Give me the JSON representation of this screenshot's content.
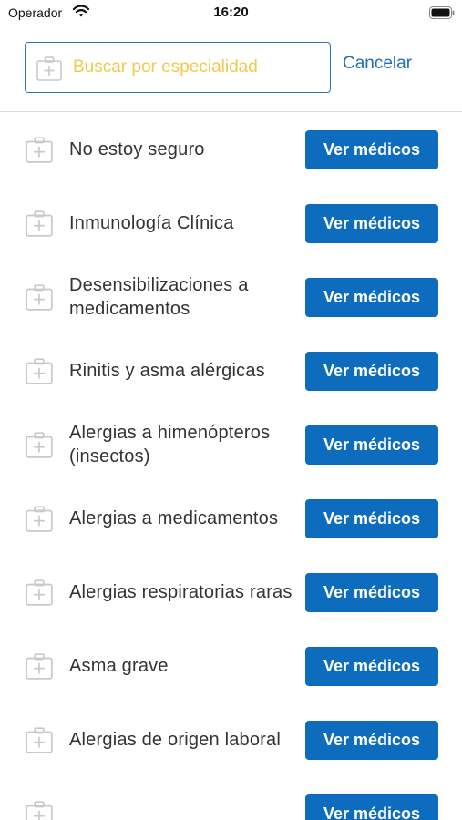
{
  "status_bar": {
    "carrier": "Operador",
    "time": "16:20"
  },
  "search": {
    "placeholder": "Buscar por especialidad",
    "value": "",
    "cancel_label": "Cancelar"
  },
  "colors": {
    "accent": "#0d6cbd",
    "placeholder": "#f2c94c",
    "search_border": "#2a74b8",
    "icon": "#c9c9c9"
  },
  "icons": {
    "specialty": "medical-briefcase-icon",
    "search": "medical-briefcase-icon"
  },
  "specialties": [
    {
      "label": "No estoy seguro",
      "button": "Ver médicos"
    },
    {
      "label": "Inmunología Clínica",
      "button": "Ver médicos"
    },
    {
      "label": "Desensibilizaciones a medicamentos",
      "button": "Ver médicos"
    },
    {
      "label": "Rinitis y asma alérgicas",
      "button": "Ver médicos"
    },
    {
      "label": "Alergias a himenópteros (insectos)",
      "button": "Ver médicos"
    },
    {
      "label": "Alergias a medicamentos",
      "button": "Ver médicos"
    },
    {
      "label": "Alergias respiratorias raras",
      "button": "Ver médicos"
    },
    {
      "label": "Asma grave",
      "button": "Ver médicos"
    },
    {
      "label": "Alergias de origen laboral",
      "button": "Ver médicos"
    },
    {
      "label": "",
      "button": "Ver médicos"
    }
  ]
}
